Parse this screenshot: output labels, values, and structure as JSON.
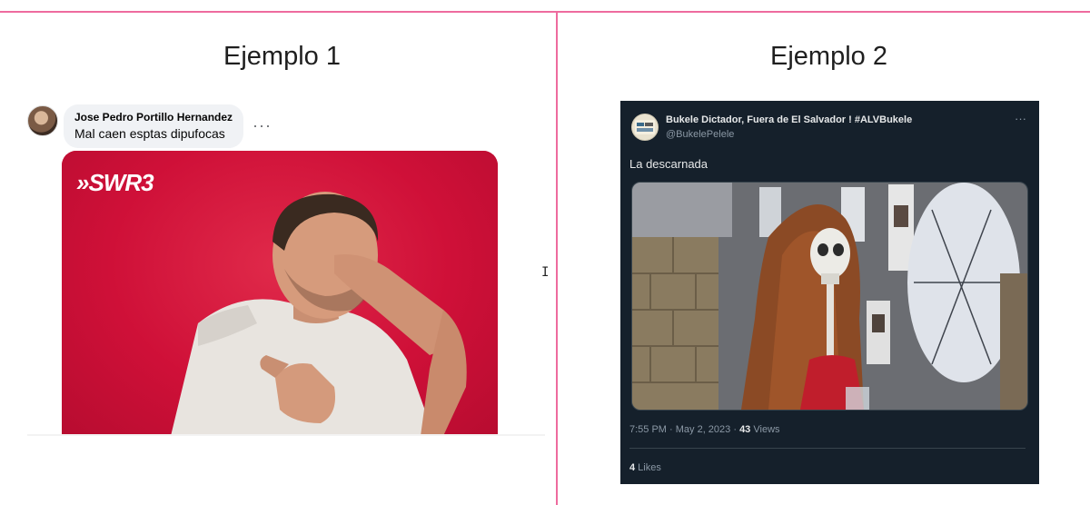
{
  "headings": {
    "left": "Ejemplo 1",
    "right": "Ejemplo 2"
  },
  "example1": {
    "commenter_name": "Jose Pedro Portillo Hernandez",
    "comment_text": "Mal caen esptas dipufocas",
    "more_label": "···",
    "gif_logo": "»SWR3"
  },
  "example2": {
    "display_name": "Bukele Dictador, Fuera de El Salvador ! #ALVBukele",
    "handle": "@BukelePelele",
    "more_label": "···",
    "tweet_text": "La descarnada",
    "time": "7:55 PM · May 2, 2023 · ",
    "views_count": "43",
    "views_label": " Views",
    "likes_count": "4",
    "likes_label": " Likes"
  },
  "colors": {
    "divider": "#ee6b9e",
    "gif_background": "#d2103b",
    "twitter_background": "#15202b"
  }
}
